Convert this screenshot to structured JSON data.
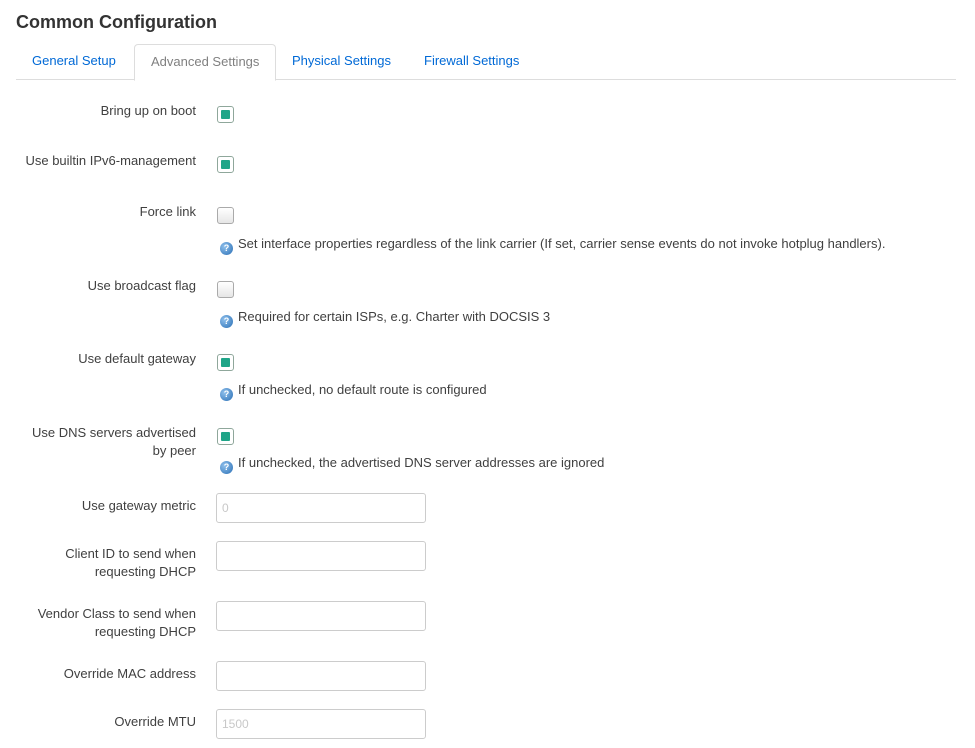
{
  "header": {
    "title": "Common Configuration"
  },
  "tabs": [
    {
      "label": "General Setup",
      "active": false
    },
    {
      "label": "Advanced Settings",
      "active": true
    },
    {
      "label": "Physical Settings",
      "active": false
    },
    {
      "label": "Firewall Settings",
      "active": false
    }
  ],
  "fields": {
    "bring_up_on_boot": {
      "label": "Bring up on boot",
      "checked": true
    },
    "builtin_ipv6": {
      "label": "Use builtin IPv6-management",
      "checked": true
    },
    "force_link": {
      "label": "Force link",
      "checked": false,
      "help": "Set interface properties regardless of the link carrier (If set, carrier sense events do not invoke hotplug handlers)."
    },
    "broadcast_flag": {
      "label": "Use broadcast flag",
      "checked": false,
      "help": "Required for certain ISPs, e.g. Charter with DOCSIS 3"
    },
    "default_gateway": {
      "label": "Use default gateway",
      "checked": true,
      "help": "If unchecked, no default route is configured"
    },
    "peer_dns": {
      "label": "Use DNS servers advertised by peer",
      "checked": true,
      "help": "If unchecked, the advertised DNS server addresses are ignored"
    },
    "gateway_metric": {
      "label": "Use gateway metric",
      "value": "",
      "placeholder": "0"
    },
    "client_id": {
      "label": "Client ID to send when requesting DHCP",
      "value": "",
      "placeholder": ""
    },
    "vendor_class": {
      "label": "Vendor Class to send when requesting DHCP",
      "value": "",
      "placeholder": ""
    },
    "override_mac": {
      "label": "Override MAC address",
      "value": "",
      "placeholder": ""
    },
    "override_mtu": {
      "label": "Override MTU",
      "value": "",
      "placeholder": "1500"
    }
  },
  "icons": {
    "help": "help-question-icon"
  },
  "colors": {
    "accent": "#1fa588",
    "link": "#0069d6"
  }
}
